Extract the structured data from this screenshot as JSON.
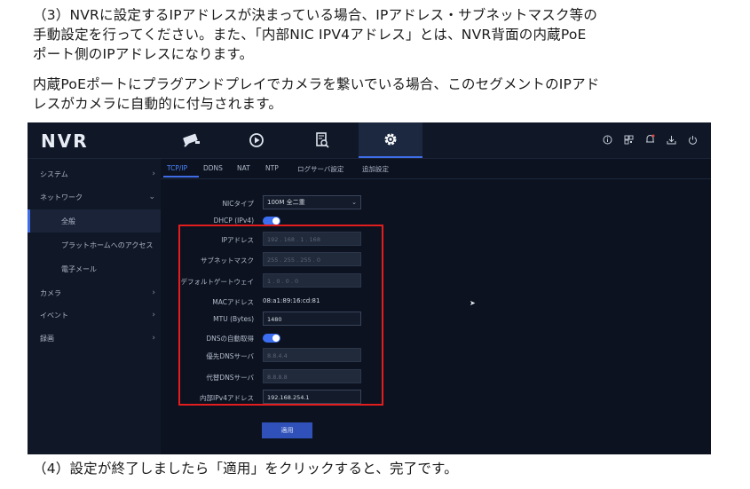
{
  "text": {
    "p1_line1": "（3）NVRに設定するIPアドレスが決まっている場合、IPアドレス・サブネットマスク等の",
    "p1_line2": "手動設定を行ってください。また、「内部NIC IPV4アドレス」とは、NVR背面の内蔵PoE",
    "p1_line3": "ポート側のIPアドレスになります。",
    "p2_line1": "内蔵PoEポートにプラグアンドプレイでカメラを繋いでいる場合、このセグメントのIPアド",
    "p2_line2": "レスがカメラに自動的に付与されます。",
    "p4": "（4）設定が終了しましたら「適用」をクリックすると、完了です。"
  },
  "nvr": {
    "logo": "NVR",
    "top_tabs": [
      {
        "icon": "camera-icon",
        "active": false
      },
      {
        "icon": "playback-icon",
        "active": false
      },
      {
        "icon": "file-search-icon",
        "active": false
      },
      {
        "icon": "gear-icon",
        "active": true
      }
    ],
    "top_right_icons": [
      "info-icon",
      "qr-icon",
      "bell-icon",
      "download-icon",
      "power-icon"
    ],
    "sidebar": [
      {
        "label": "システム",
        "arrow": "›"
      },
      {
        "label": "ネットワーク",
        "arrow": "⌄"
      },
      {
        "label": "全般",
        "sub": true,
        "active": true
      },
      {
        "label": "プラットホームへのアクセス",
        "sub": true
      },
      {
        "label": "電子メール",
        "sub": true
      },
      {
        "label": "カメラ",
        "arrow": "›"
      },
      {
        "label": "イベント",
        "arrow": "›"
      },
      {
        "label": "録画",
        "arrow": "›"
      }
    ],
    "subtabs": [
      "TCP/IP",
      "DDNS",
      "NAT",
      "NTP",
      "ログサーバ設定",
      "追加設定"
    ],
    "form": {
      "nic_type_label": "NICタイプ",
      "nic_type_value": "100M 全二重",
      "dhcp_label": "DHCP (IPv4)",
      "ip_label": "IPアドレス",
      "ip_value": "192 . 168 . 1 . 168",
      "subnet_label": "サブネットマスク",
      "subnet_value": "255 . 255 . 255 . 0",
      "gateway_label": "デフォルトゲートウェイ",
      "gateway_value": "1 . 0 . 0 . 0",
      "mac_label": "MACアドレス",
      "mac_value": "08:a1:89:16:cd:81",
      "mtu_label": "MTU (Bytes)",
      "mtu_value": "1480",
      "dns_auto_label": "DNSの自動取得",
      "pref_dns_label": "優先DNSサーバ",
      "pref_dns_value": "8.8.4.4",
      "alt_dns_label": "代替DNSサーバ",
      "alt_dns_value": "8.8.8.8",
      "internal_ip_label": "内部IPv4アドレス",
      "internal_ip_value": "192.168.254.1",
      "apply_label": "適用"
    },
    "colors": {
      "accent": "#3f6de6",
      "highlight_box": "#e21d1d",
      "background": "#0c1220"
    }
  }
}
